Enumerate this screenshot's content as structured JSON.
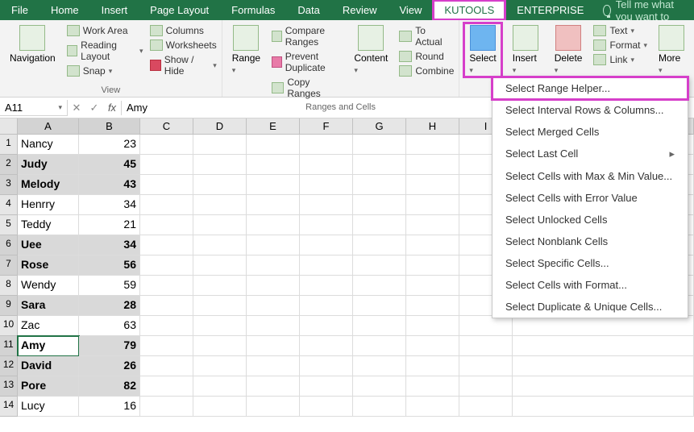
{
  "tabs": [
    "File",
    "Home",
    "Insert",
    "Page Layout",
    "Formulas",
    "Data",
    "Review",
    "View",
    "KUTOOLS",
    "ENTERPRISE"
  ],
  "active_tab": "KUTOOLS",
  "tellme": "Tell me what you want to",
  "ribbon": {
    "view": {
      "label": "View",
      "nav": "Navigation",
      "items": [
        "Work Area",
        "Reading Layout",
        "Snap"
      ],
      "col2": [
        "Columns",
        "Worksheets",
        "Show / Hide"
      ]
    },
    "ranges": {
      "label": "Ranges and Cells",
      "range": "Range",
      "col1": [
        "Compare Ranges",
        "Prevent Duplicate",
        "Copy Ranges"
      ],
      "content": "Content",
      "col2": [
        "To Actual",
        "Round",
        "Combine"
      ]
    },
    "edit": {
      "select": "Select",
      "insert": "Insert",
      "delete": "Delete",
      "text": "Text",
      "format": "Format",
      "link": "Link",
      "more": "More"
    }
  },
  "menu": [
    "Select Range Helper...",
    "Select Interval Rows & Columns...",
    "Select Merged Cells",
    "Select Last Cell",
    "Select Cells with Max & Min Value...",
    "Select Cells with Error Value",
    "Select Unlocked Cells",
    "Select Nonblank Cells",
    "Select Specific Cells...",
    "Select Cells with Format...",
    "Select Duplicate & Unique Cells..."
  ],
  "formula_bar": {
    "name": "A11",
    "fx": "fx",
    "value": "Amy"
  },
  "columns": [
    "A",
    "B",
    "C",
    "D",
    "E",
    "F",
    "G",
    "H",
    "I"
  ],
  "sheet": {
    "rows": [
      {
        "a": "Nancy",
        "b": 23,
        "bold": false
      },
      {
        "a": "Judy",
        "b": 45,
        "bold": true
      },
      {
        "a": "Melody",
        "b": 43,
        "bold": true
      },
      {
        "a": "Henrry",
        "b": 34,
        "bold": false
      },
      {
        "a": "Teddy",
        "b": 21,
        "bold": false
      },
      {
        "a": "Uee",
        "b": 34,
        "bold": true
      },
      {
        "a": "Rose",
        "b": 56,
        "bold": true
      },
      {
        "a": "Wendy",
        "b": 59,
        "bold": false
      },
      {
        "a": "Sara",
        "b": 28,
        "bold": true
      },
      {
        "a": "Zac",
        "b": 63,
        "bold": false
      },
      {
        "a": "Amy",
        "b": 79,
        "bold": true,
        "active": true
      },
      {
        "a": "David",
        "b": 26,
        "bold": true
      },
      {
        "a": "Pore",
        "b": 82,
        "bold": true
      },
      {
        "a": "Lucy",
        "b": 16,
        "bold": false
      }
    ]
  }
}
